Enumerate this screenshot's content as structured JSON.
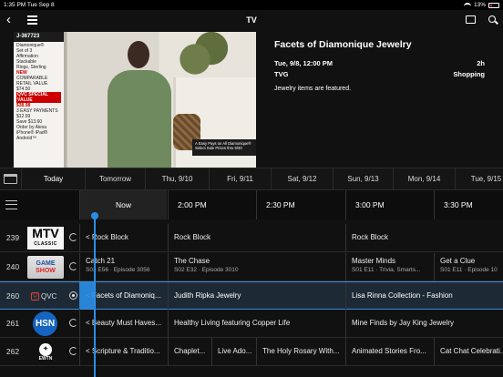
{
  "status": {
    "time_date": "1:35 PM  Tue Sep 8",
    "battery": "13%"
  },
  "nav": {
    "back_icon": "chevron-left-icon",
    "menu_icon": "hamburger-menu-icon",
    "title": "TV",
    "cast_icon": "cast-icon",
    "search_icon": "search-icon"
  },
  "player": {
    "promo_code": "J-367723",
    "promo_lines": [
      "Diamonique®",
      "Set of 3",
      "Affirmation",
      "Stackable",
      "Rings, Sterling"
    ],
    "promo_new": "NEW",
    "promo_retail_label": "COMPARABLE RETAIL VALUE",
    "promo_retail": "$74.50",
    "promo_qvc_label": "QVC SPECIAL VALUE",
    "promo_qvc": "$38.98",
    "promo_easy": "3 EASY PAYMENTS",
    "promo_easy_price": "$12.99",
    "promo_save": "Save $13.60",
    "promo_order": "Order by Alexa",
    "promo_devices": "iPhone® iPad® Android™",
    "easypay_text": "A Easy Pays on All Diamonique® Select Sale Prices thru 9/30"
  },
  "program": {
    "title": "Facets of Diamonique Jewelry",
    "airtime": "Tue, 9/8, 12:00 PM",
    "duration": "2h",
    "rating": "TVG",
    "genre": "Shopping",
    "description": "Jewelry items are featured."
  },
  "days": [
    "Today",
    "Tomorrow",
    "Thu, 9/10",
    "Fri, 9/11",
    "Sat, 9/12",
    "Sun, 9/13",
    "Mon, 9/14",
    "Tue, 9/15"
  ],
  "times": [
    "Now",
    "2:00 PM",
    "2:30 PM",
    "3:00 PM",
    "3:30 PM"
  ],
  "channels": [
    {
      "number": "239",
      "network": "MTV",
      "network_sub": "CLASSIC",
      "programs": [
        {
          "title": "< Rock Block",
          "sub": ""
        },
        {
          "title": "Rock Block",
          "sub": ""
        },
        {
          "title": "Rock Block",
          "sub": ""
        }
      ]
    },
    {
      "number": "240",
      "network": "GAME",
      "network_sub": "SHOW",
      "programs": [
        {
          "title": "Catch 21",
          "sub": "S03 E56 · Episode 3056"
        },
        {
          "title": "The Chase",
          "sub": "S02 E32 · Episode 3010"
        },
        {
          "title": "Master Minds",
          "sub": "S01 E11 · Trivia, Smarts..."
        },
        {
          "title": "Get a Clue",
          "sub": "S01 E11 · Episode 10"
        }
      ]
    },
    {
      "number": "260",
      "network": "QVC",
      "network_sub": "",
      "programs": [
        {
          "title": "< Facets of Diamoniq...",
          "sub": ""
        },
        {
          "title": "Judith Ripka Jewelry",
          "sub": ""
        },
        {
          "title": "Lisa Rinna Collection - Fashion",
          "sub": ""
        }
      ]
    },
    {
      "number": "261",
      "network": "HSN",
      "network_sub": "",
      "programs": [
        {
          "title": "< Beauty Must Haves...",
          "sub": ""
        },
        {
          "title": "Healthy Living featuring Copper Life",
          "sub": ""
        },
        {
          "title": "Mine Finds by Jay King Jewelry",
          "sub": ""
        }
      ]
    },
    {
      "number": "262",
      "network": "EWTN",
      "network_sub": "",
      "programs": [
        {
          "title": "< Scripture & Traditio...",
          "sub": ""
        },
        {
          "title": "Chaplet...",
          "sub": ""
        },
        {
          "title": "Live Ado...",
          "sub": ""
        },
        {
          "title": "The Holy Rosary With...",
          "sub": ""
        },
        {
          "title": "Animated Stories Fro...",
          "sub": ""
        },
        {
          "title": "Cat Chat Celebrati...",
          "sub": ""
        }
      ]
    }
  ],
  "colors": {
    "accent": "#2a8ee6",
    "background": "#111111"
  }
}
